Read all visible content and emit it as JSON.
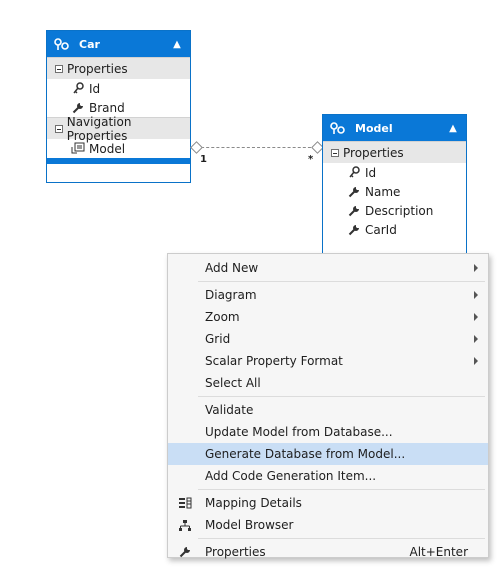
{
  "car": {
    "title": "Car",
    "properties_label": "Properties",
    "properties": [
      "Id",
      "Brand"
    ],
    "nav_label": "Navigation Properties",
    "nav_properties": [
      "Model"
    ]
  },
  "model": {
    "title": "Model",
    "properties_label": "Properties",
    "properties": [
      "Id",
      "Name",
      "Description",
      "CarId"
    ]
  },
  "association": {
    "left_multiplicity": "1",
    "right_multiplicity": "*"
  },
  "menu": {
    "add_new": "Add New",
    "diagram": "Diagram",
    "zoom": "Zoom",
    "grid": "Grid",
    "scalar_property_format": "Scalar Property Format",
    "select_all": "Select All",
    "validate": "Validate",
    "update_model": "Update Model from Database...",
    "generate_db": "Generate Database from Model...",
    "add_code_gen": "Add Code Generation Item...",
    "mapping_details": "Mapping Details",
    "model_browser": "Model Browser",
    "properties": "Properties",
    "properties_shortcut": "Alt+Enter"
  },
  "colors": {
    "entity_header": "#0a78d7",
    "menu_highlight": "#c9def5"
  }
}
